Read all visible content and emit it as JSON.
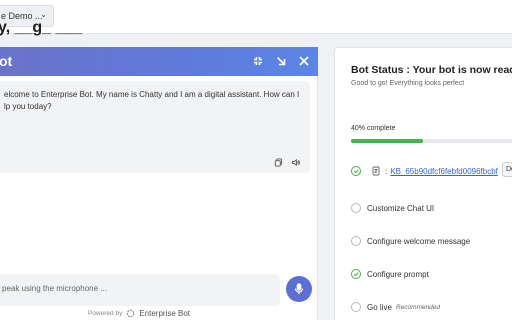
{
  "topbar": {
    "demo_select_value": "e Demo ...",
    "page_heading": "y, __g_ ___"
  },
  "chat": {
    "title": "ot",
    "bot_message": "elcome to Enterprise Bot. My name is Chatty and I am a digital assistant. How can I lp you today?",
    "input_placeholder": "peak using the microphone ...",
    "powered_by_label": "Powered by",
    "powered_by_brand": "Enterprise Bot"
  },
  "status": {
    "title": "Bot Status : Your bot is now ready to",
    "subtitle": "Good to go! Everything looks perfect",
    "progress_label": "40% complete",
    "progress_value": 0.4,
    "kb_separator": ":",
    "kb_id": "KB_65b90dfcf6febfd0096fbcbf",
    "kb_action": "De",
    "steps": [
      {
        "label": "Customize Chat UI",
        "done": false
      },
      {
        "label": "Configure welcome message",
        "done": false
      },
      {
        "label": "Configure prompt",
        "done": true
      },
      {
        "label": "Go live",
        "done": false,
        "tag": "Recommended"
      }
    ]
  },
  "colors": {
    "accent": "#5b6fd6",
    "success": "#4caf50",
    "link": "#3a66c4"
  }
}
